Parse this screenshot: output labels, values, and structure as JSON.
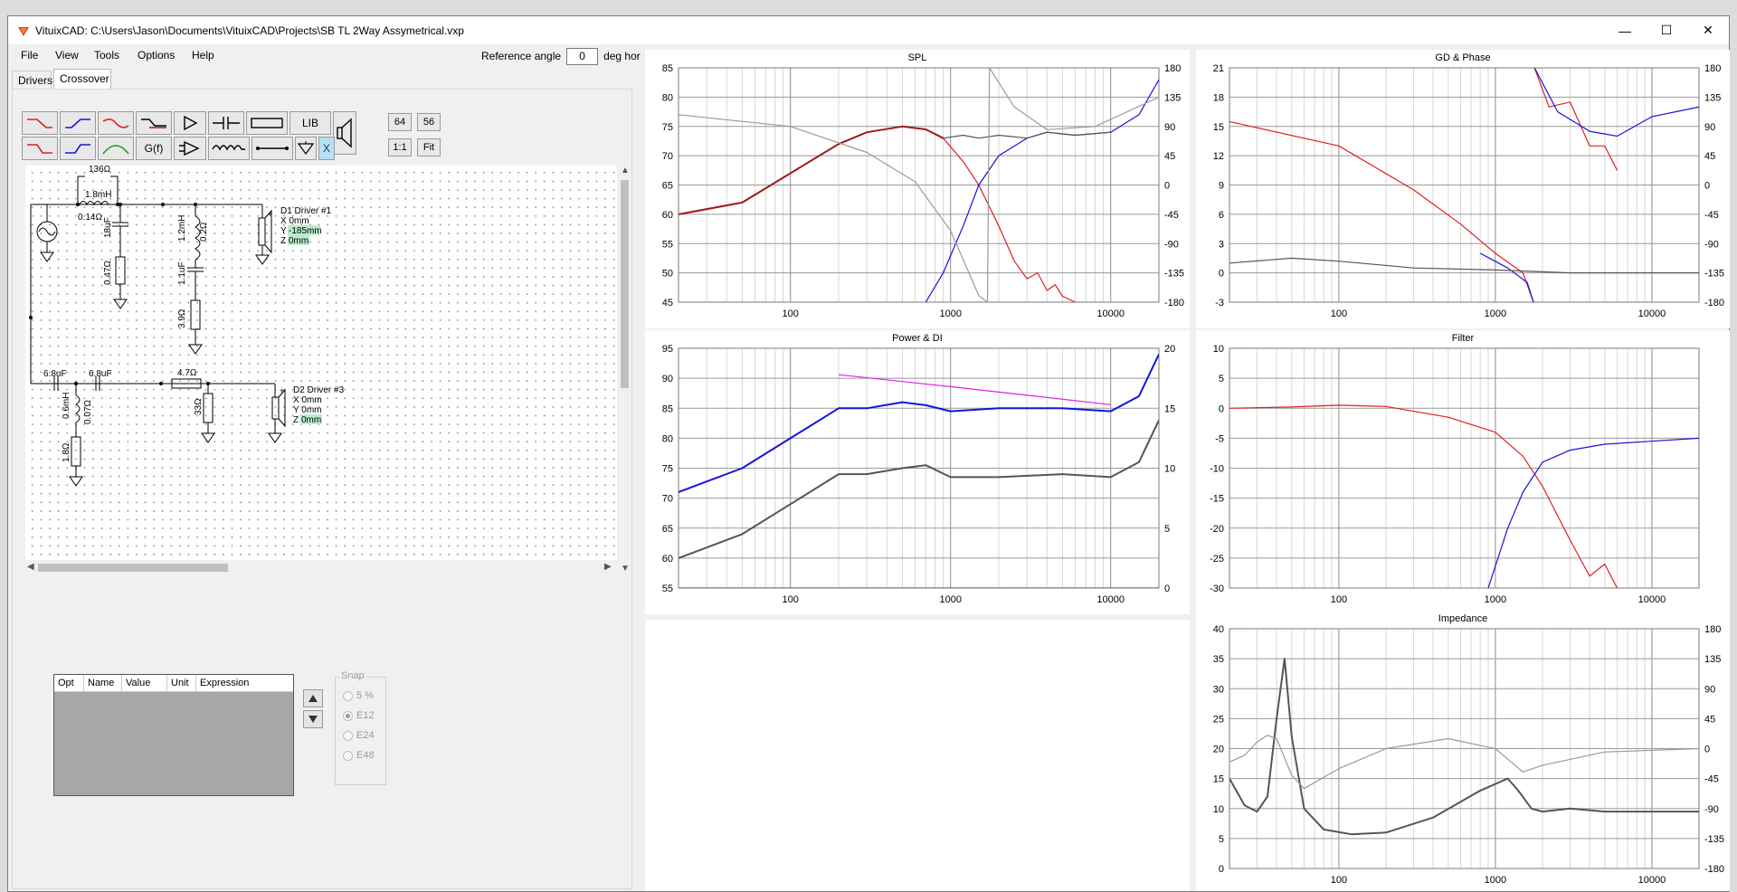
{
  "window": {
    "title": "VituixCAD: C:\\Users\\Jason\\Documents\\VituixCAD\\Projects\\SB TL 2Way Assymetrical.vxp",
    "minimize": "—",
    "maximize": "☐",
    "close": "✕"
  },
  "menu": {
    "file": "File",
    "view": "View",
    "tools": "Tools",
    "options": "Options",
    "help": "Help"
  },
  "reference": {
    "label": "Reference angle",
    "value": "0",
    "unit": "deg hor"
  },
  "tabs": {
    "drivers": "Drivers",
    "crossover": "Crossover"
  },
  "toolbar": {
    "gf": "G(f)",
    "lib": "LIB",
    "x": "X",
    "n64": "64",
    "n56": "56",
    "one_to_one": "1:1",
    "fit": "Fit"
  },
  "schematic": {
    "r1": "136Ω",
    "l1": "1.8mH",
    "l1_r": "0.14Ω",
    "c1": "18uF",
    "r2": "0.47Ω",
    "l2": "1.2mH",
    "l2_r": "0.2Ω",
    "c2": "1.1uF",
    "r3": "3.9Ω",
    "driver1": {
      "name": "D1 Driver #1",
      "x": "X 0mm",
      "y_label": "Y",
      "y": "-185mm",
      "z_label": "Z",
      "z": "0mm"
    },
    "c3": "6.8uF",
    "c4": "6.8uF",
    "r4": "4.7Ω",
    "l3": "0.6mH",
    "l3_r": "0.07Ω",
    "r5": "1.8Ω",
    "r6": "33Ω",
    "driver2": {
      "name": "D2 Driver #3",
      "x": "X 0mm",
      "y": "Y 0mm",
      "z_label": "Z",
      "z": "0mm"
    }
  },
  "variables": {
    "headers": [
      "Opt",
      "Name",
      "Value",
      "Unit",
      "Expression"
    ]
  },
  "snap": {
    "title": "Snap",
    "options": [
      "5 %",
      "E12",
      "E24",
      "E48"
    ],
    "selected": "E12"
  },
  "colors": {
    "red": "#e02020",
    "dark_red": "#a01818",
    "blue": "#1414d8",
    "gray": "#555555",
    "light_gray": "#9a9a9a",
    "magenta": "#e020e0"
  },
  "chart_data": [
    {
      "type": "line",
      "title": "SPL",
      "x_scale": "log",
      "xlim": [
        20,
        20000
      ],
      "xticks": [
        "100",
        "1000",
        "10000"
      ],
      "ylim": [
        45,
        85
      ],
      "yticks": [
        "45",
        "50",
        "55",
        "60",
        "65",
        "70",
        "75",
        "80",
        "85"
      ],
      "y2lim": [
        -180,
        180
      ],
      "y2ticks": [
        "-180",
        "-135",
        "-90",
        "-45",
        "0",
        "45",
        "90",
        "135",
        "180"
      ],
      "series": [
        {
          "color": "#e02020",
          "axis": "left",
          "x": [
            20,
            50,
            100,
            200,
            300,
            500,
            700,
            900,
            1200,
            1500,
            2000,
            2500,
            3000,
            3500,
            4000,
            4500,
            5000,
            6000
          ],
          "y": [
            60,
            62,
            67,
            72,
            74,
            75,
            74.5,
            73,
            69,
            65,
            58,
            52,
            49,
            50,
            47,
            48,
            46,
            45
          ]
        },
        {
          "color": "#1414d8",
          "axis": "left",
          "x": [
            700,
            900,
            1200,
            1500,
            2000,
            3000,
            4000,
            6000,
            10000,
            15000,
            20000
          ],
          "y": [
            45,
            50,
            58,
            65,
            70,
            73,
            74,
            73.5,
            74,
            77,
            83
          ]
        },
        {
          "color": "#a01818",
          "axis": "left",
          "x": [
            20,
            50,
            100,
            200,
            300,
            500,
            700,
            900
          ],
          "y": [
            60,
            62,
            67,
            72,
            74,
            75,
            74.5,
            73
          ]
        },
        {
          "color": "#555555",
          "axis": "left",
          "x": [
            900,
            1200,
            1500,
            2000,
            3000,
            4000,
            6000,
            10000
          ],
          "y": [
            73,
            73.5,
            73,
            73.5,
            73,
            74,
            73.5,
            74
          ]
        },
        {
          "color": "#9a9a9a",
          "axis": "right",
          "x": [
            20,
            100,
            300,
            600,
            1000,
            1500,
            1700,
            1750,
            2500,
            4000,
            8000,
            20000
          ],
          "y": [
            108,
            90,
            50,
            5,
            -70,
            -170,
            -180,
            180,
            120,
            85,
            90,
            135
          ]
        }
      ]
    },
    {
      "type": "line",
      "title": "GD & Phase",
      "x_scale": "log",
      "xlim": [
        20,
        20000
      ],
      "xticks": [
        "100",
        "1000",
        "10000"
      ],
      "ylim": [
        -3,
        21
      ],
      "yticks": [
        "-3",
        "0",
        "3",
        "6",
        "9",
        "12",
        "15",
        "18",
        "21"
      ],
      "y2lim": [
        -180,
        180
      ],
      "y2ticks": [
        "-180",
        "-135",
        "-90",
        "-45",
        "0",
        "45",
        "90",
        "135",
        "180"
      ],
      "series": [
        {
          "color": "#e02020",
          "axis": "left",
          "x": [
            20,
            100,
            300,
            600,
            1000,
            1500,
            1750
          ],
          "y": [
            15.5,
            13,
            8.5,
            5,
            2,
            0,
            -3
          ]
        },
        {
          "color": "#e02020",
          "axis": "left",
          "x": [
            1780,
            2200,
            3000,
            4000,
            5000,
            6000
          ],
          "y": [
            21,
            17,
            17.5,
            13,
            13,
            10.5
          ]
        },
        {
          "color": "#1414d8",
          "axis": "left",
          "x": [
            800,
            1200,
            1600,
            1750
          ],
          "y": [
            2,
            0.5,
            -1,
            -3
          ]
        },
        {
          "color": "#1414d8",
          "axis": "left",
          "x": [
            1780,
            2500,
            4000,
            6000,
            10000,
            20000
          ],
          "y": [
            21,
            16.5,
            14.5,
            14,
            16,
            17
          ]
        },
        {
          "color": "#555555",
          "axis": "left",
          "x": [
            20,
            50,
            100,
            300,
            1000,
            3000,
            20000
          ],
          "y": [
            1,
            1.5,
            1.2,
            0.5,
            0.3,
            0,
            0
          ]
        }
      ]
    },
    {
      "type": "line",
      "title": "Power & DI",
      "x_scale": "log",
      "xlim": [
        20,
        20000
      ],
      "xticks": [
        "100",
        "1000",
        "10000"
      ],
      "ylim": [
        55,
        95
      ],
      "yticks": [
        "55",
        "60",
        "65",
        "70",
        "75",
        "80",
        "85",
        "90",
        "95"
      ],
      "y2lim": [
        0,
        20
      ],
      "y2ticks": [
        "0",
        "5",
        "10",
        "15",
        "20"
      ],
      "series": [
        {
          "color": "#1414d8",
          "axis": "left",
          "x": [
            20,
            50,
            100,
            200,
            300,
            500,
            700,
            1000,
            2000,
            5000,
            10000,
            15000,
            20000
          ],
          "y": [
            71,
            75,
            80,
            85,
            85,
            86,
            85.5,
            84.5,
            85,
            85,
            84.5,
            87,
            94
          ]
        },
        {
          "color": "#555555",
          "axis": "left",
          "x": [
            20,
            50,
            100,
            200,
            300,
            500,
            700,
            1000,
            2000,
            5000,
            10000,
            15000,
            20000
          ],
          "y": [
            60,
            64,
            69,
            74,
            74,
            75,
            75.5,
            73.5,
            73.5,
            74,
            73.5,
            76,
            83
          ]
        },
        {
          "color": "#e020e0",
          "axis": "right",
          "x": [
            200,
            1000,
            10000
          ],
          "y": [
            17.8,
            16.8,
            15.3
          ]
        },
        {
          "color": "#e02020",
          "axis": "right",
          "x": [
            20,
            20000
          ],
          "y": [
            0,
            0
          ]
        }
      ]
    },
    {
      "type": "line",
      "title": "Filter",
      "x_scale": "log",
      "xlim": [
        20,
        20000
      ],
      "xticks": [
        "100",
        "1000",
        "10000"
      ],
      "ylim": [
        -30,
        10
      ],
      "yticks": [
        "-30",
        "-25",
        "-20",
        "-15",
        "-10",
        "-5",
        "0",
        "5",
        "10"
      ],
      "series": [
        {
          "color": "#e02020",
          "x": [
            20,
            50,
            100,
            200,
            500,
            1000,
            1500,
            2000,
            3000,
            4000,
            5000,
            6000
          ],
          "y": [
            0,
            0.2,
            0.5,
            0.3,
            -1.5,
            -4,
            -8,
            -13,
            -22,
            -28,
            -26,
            -30
          ]
        },
        {
          "color": "#1414d8",
          "x": [
            900,
            1200,
            1500,
            2000,
            3000,
            5000,
            10000,
            20000
          ],
          "y": [
            -30,
            -20,
            -14,
            -9,
            -7,
            -6,
            -5.5,
            -5
          ]
        }
      ]
    },
    {
      "type": "line",
      "title": "Impedance",
      "x_scale": "log",
      "xlim": [
        20,
        20000
      ],
      "xticks": [
        "100",
        "1000",
        "10000"
      ],
      "ylim": [
        0,
        40
      ],
      "yticks": [
        "0",
        "5",
        "10",
        "15",
        "20",
        "25",
        "30",
        "35",
        "40"
      ],
      "y2lim": [
        -180,
        180
      ],
      "y2ticks": [
        "-180",
        "-135",
        "-90",
        "-45",
        "0",
        "45",
        "90",
        "135",
        "180"
      ],
      "series": [
        {
          "color": "#555555",
          "axis": "left",
          "x": [
            20,
            25,
            30,
            35,
            40,
            45,
            50,
            60,
            80,
            120,
            200,
            400,
            800,
            1200,
            1400,
            1700,
            2000,
            3000,
            5000,
            20000
          ],
          "y": [
            15,
            10.5,
            9.5,
            12,
            25,
            35,
            22,
            10,
            6.5,
            5.7,
            6,
            8.5,
            13,
            15,
            13,
            10,
            9.5,
            10,
            9.5,
            9.5
          ]
        },
        {
          "color": "#9a9a9a",
          "axis": "right",
          "x": [
            20,
            25,
            30,
            35,
            40,
            50,
            60,
            100,
            200,
            500,
            1000,
            1500,
            2000,
            5000,
            20000
          ],
          "y": [
            -20,
            -10,
            10,
            20,
            15,
            -40,
            -60,
            -30,
            0,
            15,
            0,
            -35,
            -25,
            -5,
            0
          ]
        }
      ]
    }
  ]
}
